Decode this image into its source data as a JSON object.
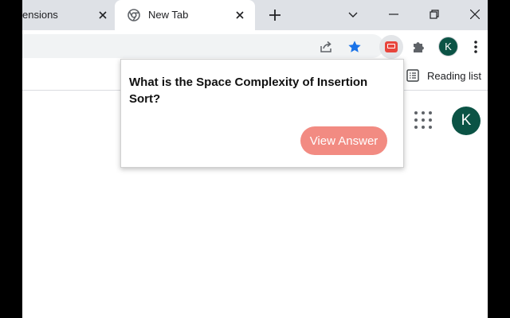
{
  "tabs": [
    {
      "title": "ensions"
    },
    {
      "title": "New Tab"
    }
  ],
  "toolbar": {
    "profile_initial": "K"
  },
  "bookmark_bar": {
    "reading_list_label": "Reading list"
  },
  "page": {
    "avatar_initial": "K"
  },
  "popup": {
    "question": "What is the Space Complexity of Insertion Sort?",
    "button_label": "View Answer"
  },
  "colors": {
    "tabstrip": "#dee1e6",
    "accent_star": "#1a73e8",
    "avatar": "#0b5345",
    "button": "#f28b82",
    "extension_icon": "#e8453c"
  }
}
